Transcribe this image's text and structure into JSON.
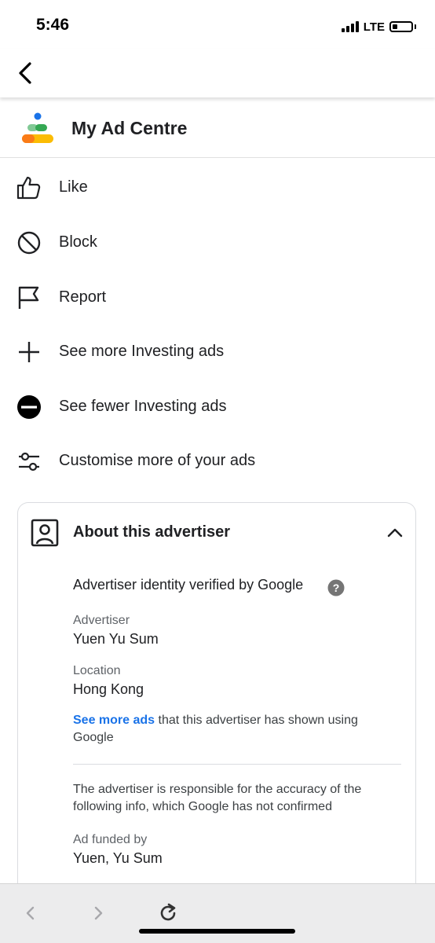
{
  "status": {
    "time": "5:46",
    "network": "LTE",
    "battery_level": 0.25
  },
  "top_bar": {
    "back_icon": "chevron-left-icon"
  },
  "brand": {
    "title": "My Ad Centre",
    "logo_icon": "ad-centre-logo-icon"
  },
  "menu": [
    {
      "label": "Like",
      "icon": "thumbs-up-icon"
    },
    {
      "label": "Block",
      "icon": "block-icon"
    },
    {
      "label": "Report",
      "icon": "flag-icon"
    },
    {
      "label": "See more Investing ads",
      "icon": "plus-icon"
    },
    {
      "label": "See fewer Investing ads",
      "icon": "minus-circle-icon"
    },
    {
      "label": "Customise more of your ads",
      "icon": "sliders-icon"
    }
  ],
  "advertiser": {
    "title": "About this advertiser",
    "verified": "Advertiser identity verified by Google",
    "advertiser_label": "Advertiser",
    "advertiser_value": "Yuen Yu Sum",
    "location_label": "Location",
    "location_value": "Hong Kong",
    "see_more_link": "See more ads",
    "see_more_rest": " that this advertiser has shown using Google",
    "disclaimer": "The advertiser is responsible for the accuracy of the following info, which Google has not confirmed",
    "funded_label": "Ad funded by",
    "funded_value": "Yuen, Yu Sum"
  },
  "colors": {
    "link": "#1a73e8",
    "logo_blue": "#1a73e8",
    "logo_green": "#34a853",
    "logo_orange": "#fa7b17",
    "logo_yellow": "#fbbc04"
  }
}
